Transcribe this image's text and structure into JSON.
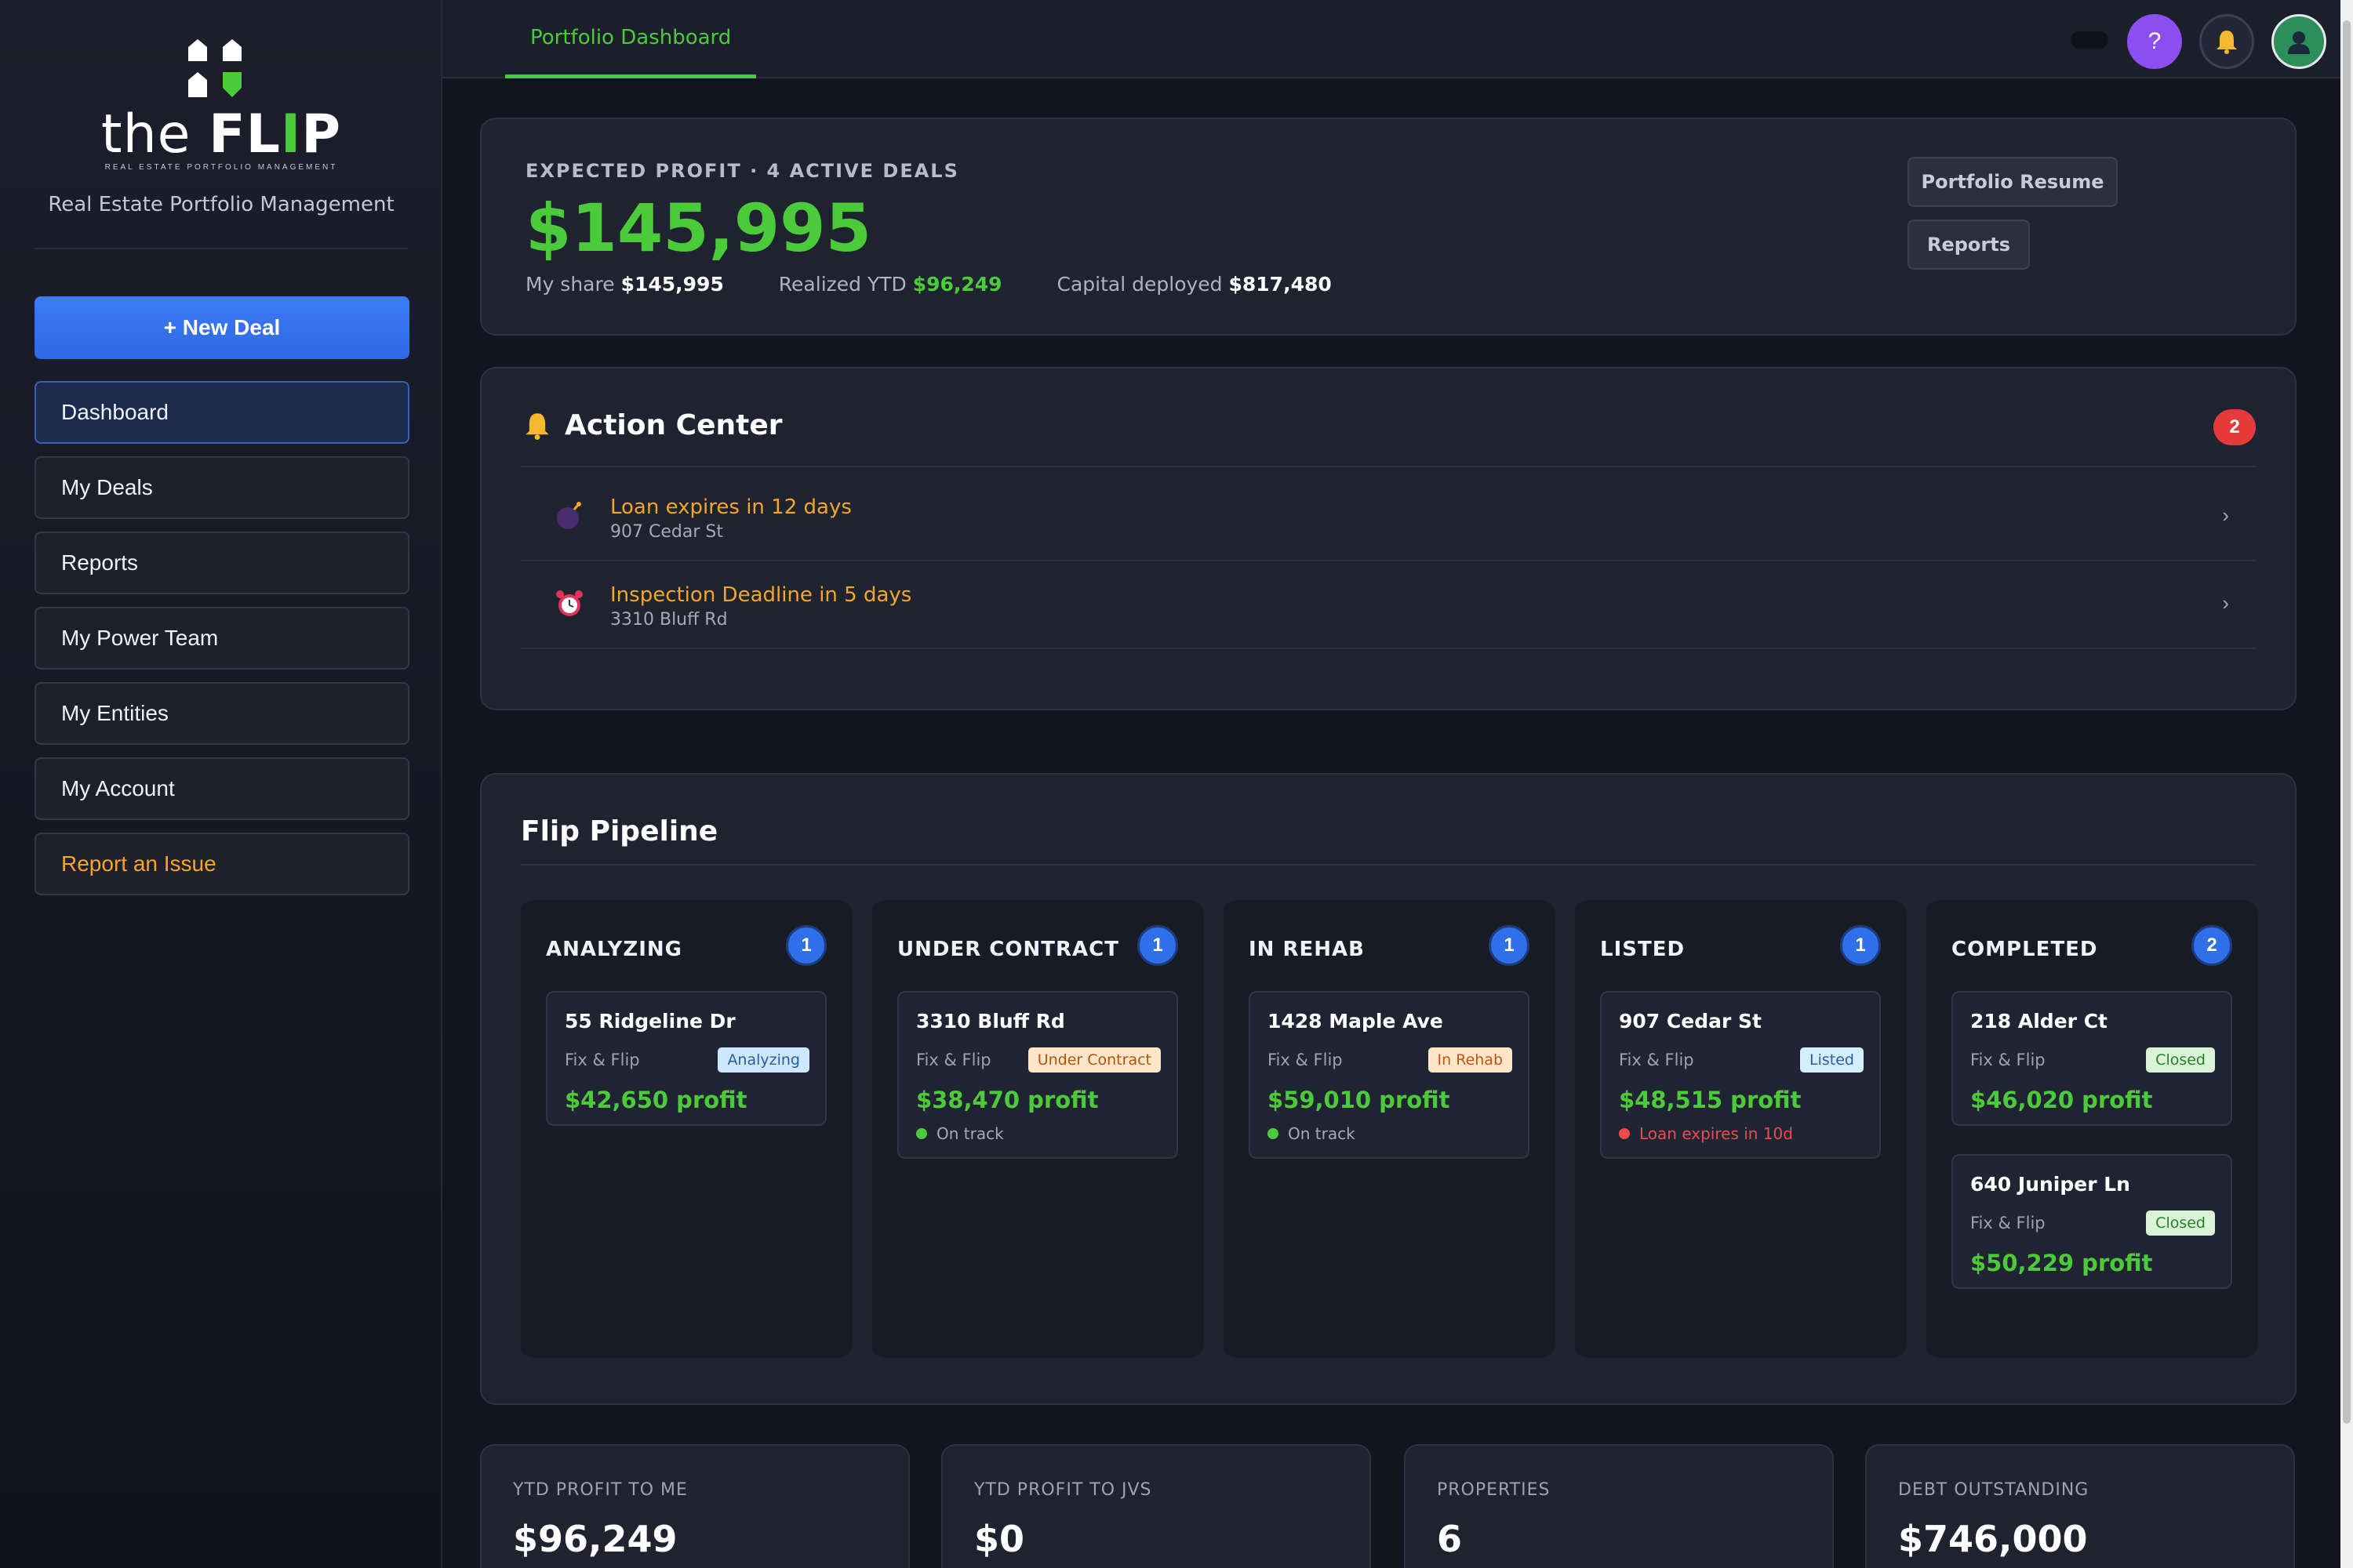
{
  "app": {
    "logo_the": "the",
    "logo_flip_1": "FL",
    "logo_flip_2": "I",
    "logo_flip_3": "P",
    "logo_sub": "REAL ESTATE PORTFOLIO MANAGEMENT",
    "tagline": "Real Estate Portfolio Management"
  },
  "sidebar": {
    "new_deal": "+ New Deal",
    "items": [
      {
        "label": "Dashboard",
        "active": true
      },
      {
        "label": "My Deals"
      },
      {
        "label": "Reports"
      },
      {
        "label": "My Power Team"
      },
      {
        "label": "My Entities"
      },
      {
        "label": "My Account"
      },
      {
        "label": "Report an Issue",
        "color": "#f5a623"
      }
    ]
  },
  "topbar": {
    "tab": "Portfolio Dashboard",
    "help": "?",
    "icons": [
      "help-icon",
      "bell-icon",
      "user-avatar-icon"
    ]
  },
  "profit": {
    "label": "EXPECTED PROFIT · 4 ACTIVE DEALS",
    "value": "$145,995",
    "my_share_label": "My share",
    "my_share_value": "$145,995",
    "realized_label": "Realized YTD",
    "realized_value": "$96,249",
    "capital_label": "Capital deployed",
    "capital_value": "$817,480",
    "btn_resume": "Portfolio Resume",
    "btn_reports": "Reports"
  },
  "action_center": {
    "title": "Action Center",
    "count": "2",
    "items": [
      {
        "title": "Loan expires in 12 days",
        "subtitle": "907 Cedar St",
        "icon": "bomb-icon"
      },
      {
        "title": "Inspection Deadline in 5 days",
        "subtitle": "3310 Bluff Rd",
        "icon": "alarm-clock-icon"
      }
    ]
  },
  "pipeline": {
    "title": "Flip Pipeline",
    "columns": [
      {
        "name": "ANALYZING",
        "count": "1",
        "deals": [
          {
            "address": "55 Ridgeline Dr",
            "type": "Fix & Flip",
            "tag": "Analyzing",
            "profit": "$42,650 profit",
            "status": ""
          }
        ]
      },
      {
        "name": "UNDER CONTRACT",
        "count": "1",
        "deals": [
          {
            "address": "3310 Bluff Rd",
            "type": "Fix & Flip",
            "tag": "Under Contract",
            "profit": "$38,470 profit",
            "status": "On track"
          }
        ]
      },
      {
        "name": "IN REHAB",
        "count": "1",
        "deals": [
          {
            "address": "1428 Maple Ave",
            "type": "Fix & Flip",
            "tag": "In Rehab",
            "profit": "$59,010 profit",
            "status": "On track"
          }
        ]
      },
      {
        "name": "LISTED",
        "count": "1",
        "deals": [
          {
            "address": "907 Cedar St",
            "type": "Fix & Flip",
            "tag": "Listed",
            "profit": "$48,515 profit",
            "status": "Loan expires in 10d"
          }
        ]
      },
      {
        "name": "COMPLETED",
        "count": "2",
        "deals": [
          {
            "address": "218 Alder Ct",
            "type": "Fix & Flip",
            "tag": "Closed",
            "profit": "$46,020 profit",
            "status": ""
          },
          {
            "address": "640 Juniper Ln",
            "type": "Fix & Flip",
            "tag": "Closed",
            "profit": "$50,229 profit",
            "status": ""
          }
        ]
      }
    ]
  },
  "stats": [
    {
      "label": "YTD PROFIT TO ME",
      "value": "$96,249"
    },
    {
      "label": "YTD PROFIT TO JVS",
      "value": "$0"
    },
    {
      "label": "PROPERTIES",
      "value": "6"
    },
    {
      "label": "DEBT OUTSTANDING",
      "value": "$746,000"
    }
  ],
  "colors": {
    "accent_green": "#4ccb3a",
    "accent_blue": "#2f6fe8",
    "warning_orange": "#f5a623",
    "danger_red": "#e53a3a",
    "help_purple": "#8b4ff0",
    "tag_analyzing": "#cfe6ff",
    "tag_under_contract": "#ffe6c7",
    "tag_in_rehab": "#ffe6c7",
    "tag_listed": "#d6ecff",
    "tag_closed": "#d9f5d6"
  }
}
